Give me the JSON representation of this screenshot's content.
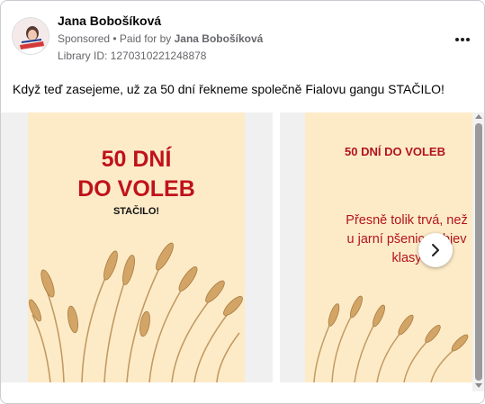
{
  "post": {
    "author": "Jana Bobošíková",
    "sponsored_label": "Sponsored",
    "separator": " • ",
    "paid_for_prefix": "Paid for by ",
    "paid_for_name": "Jana Bobošíková",
    "library_id": "Library ID: 1270310221248878",
    "more_icon": "more-horizontal-icon",
    "text": "Když teď zasejeme, už za 50 dní řekneme společně Fialovu gangu STAČILO!"
  },
  "carousel": {
    "cards": [
      {
        "title_line1": "50 DNÍ",
        "title_line2": "DO VOLEB",
        "subtitle": "STAČILO!"
      },
      {
        "title": "50 DNÍ DO VOLEB",
        "text_line1": "Přesně tolik trvá, než",
        "text_line2": "u jarní pšenice objev",
        "text_line3": "klasy"
      }
    ],
    "next_icon": "chevron-right-icon"
  },
  "colors": {
    "poster_background": "#fdebc8",
    "headline_red": "#c0121b",
    "wheat": "#c79a5c"
  }
}
